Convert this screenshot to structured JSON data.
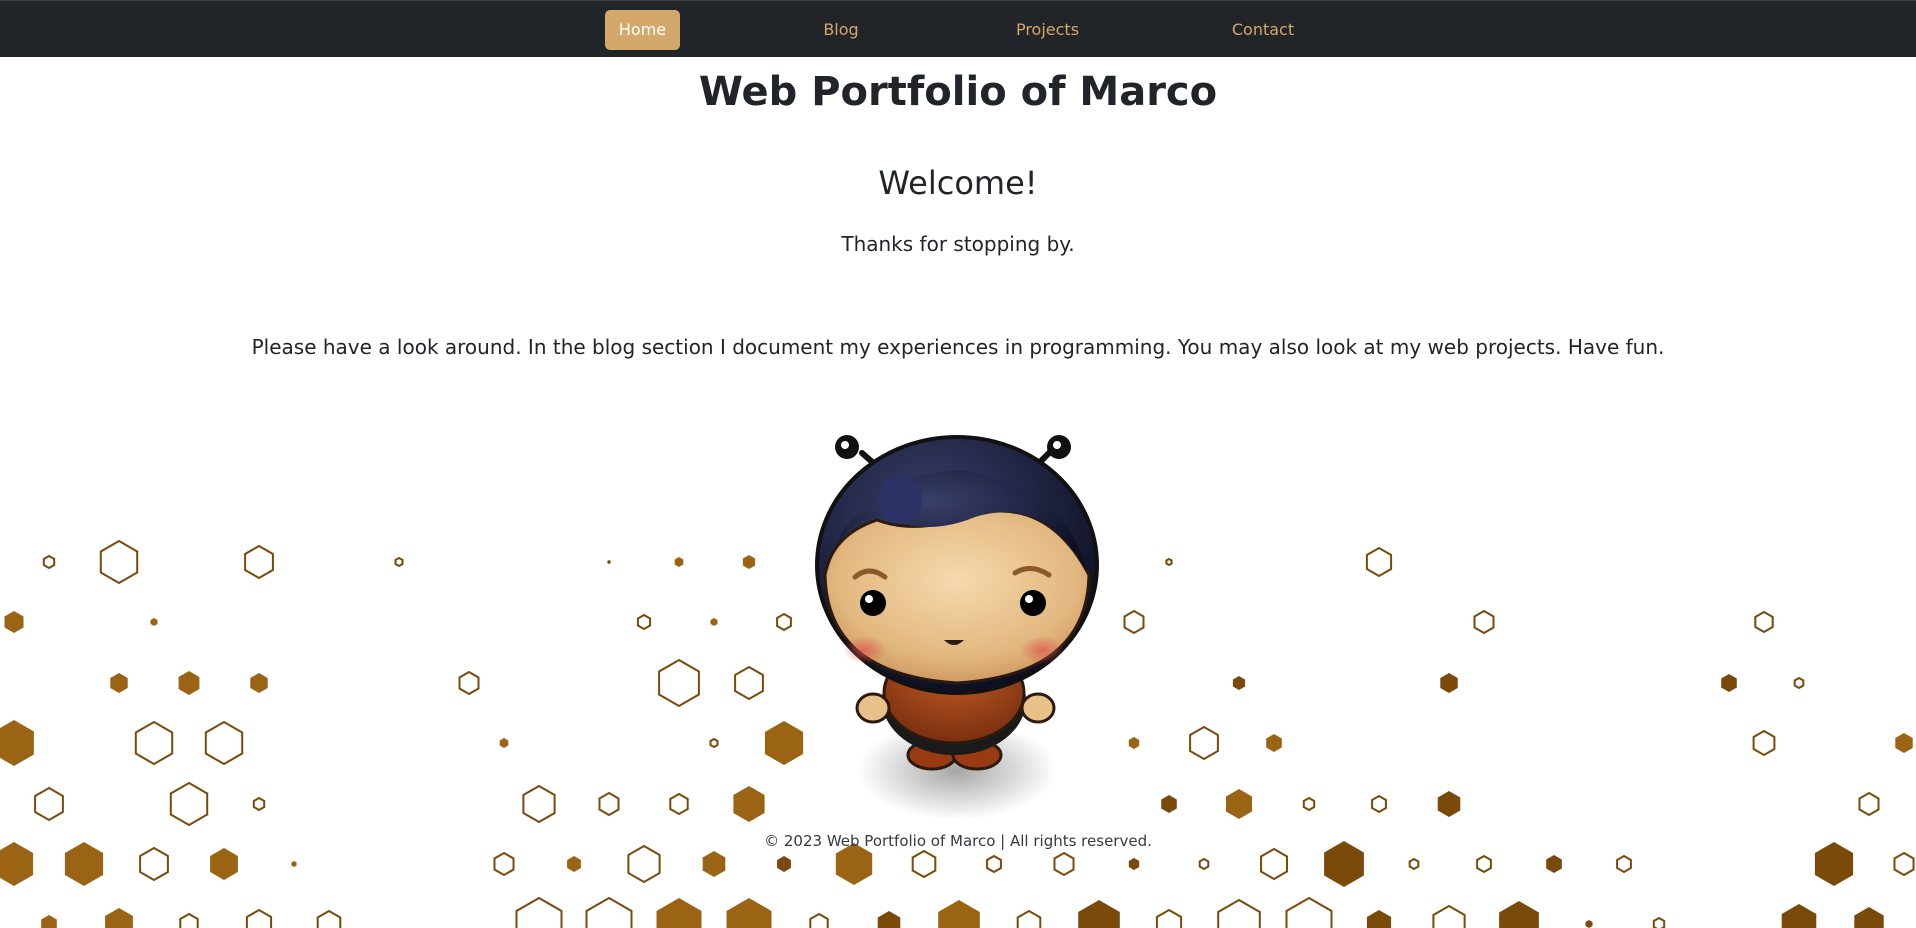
{
  "nav": {
    "items": [
      {
        "label": "Home",
        "active": true
      },
      {
        "label": "Blog",
        "active": false
      },
      {
        "label": "Projects",
        "active": false
      },
      {
        "label": "Contact",
        "active": false
      }
    ]
  },
  "main": {
    "title": "Web Portfolio of Marco",
    "welcome": "Welcome!",
    "thanks": "Thanks for stopping by.",
    "intro": "Please have a look around. In the blog section I document my experiences in programming. You may also look at my web projects. Have fun."
  },
  "footer": {
    "copyright": "© 2023 Web Portfolio of Marco | All rights reserved."
  },
  "colors": {
    "navbar_bg": "#212529",
    "nav_accent": "#d4a86a",
    "hex_fill_light": "#9a6414",
    "hex_fill_dark": "#7a4a0a",
    "hex_stroke": "#7a4a0a"
  }
}
